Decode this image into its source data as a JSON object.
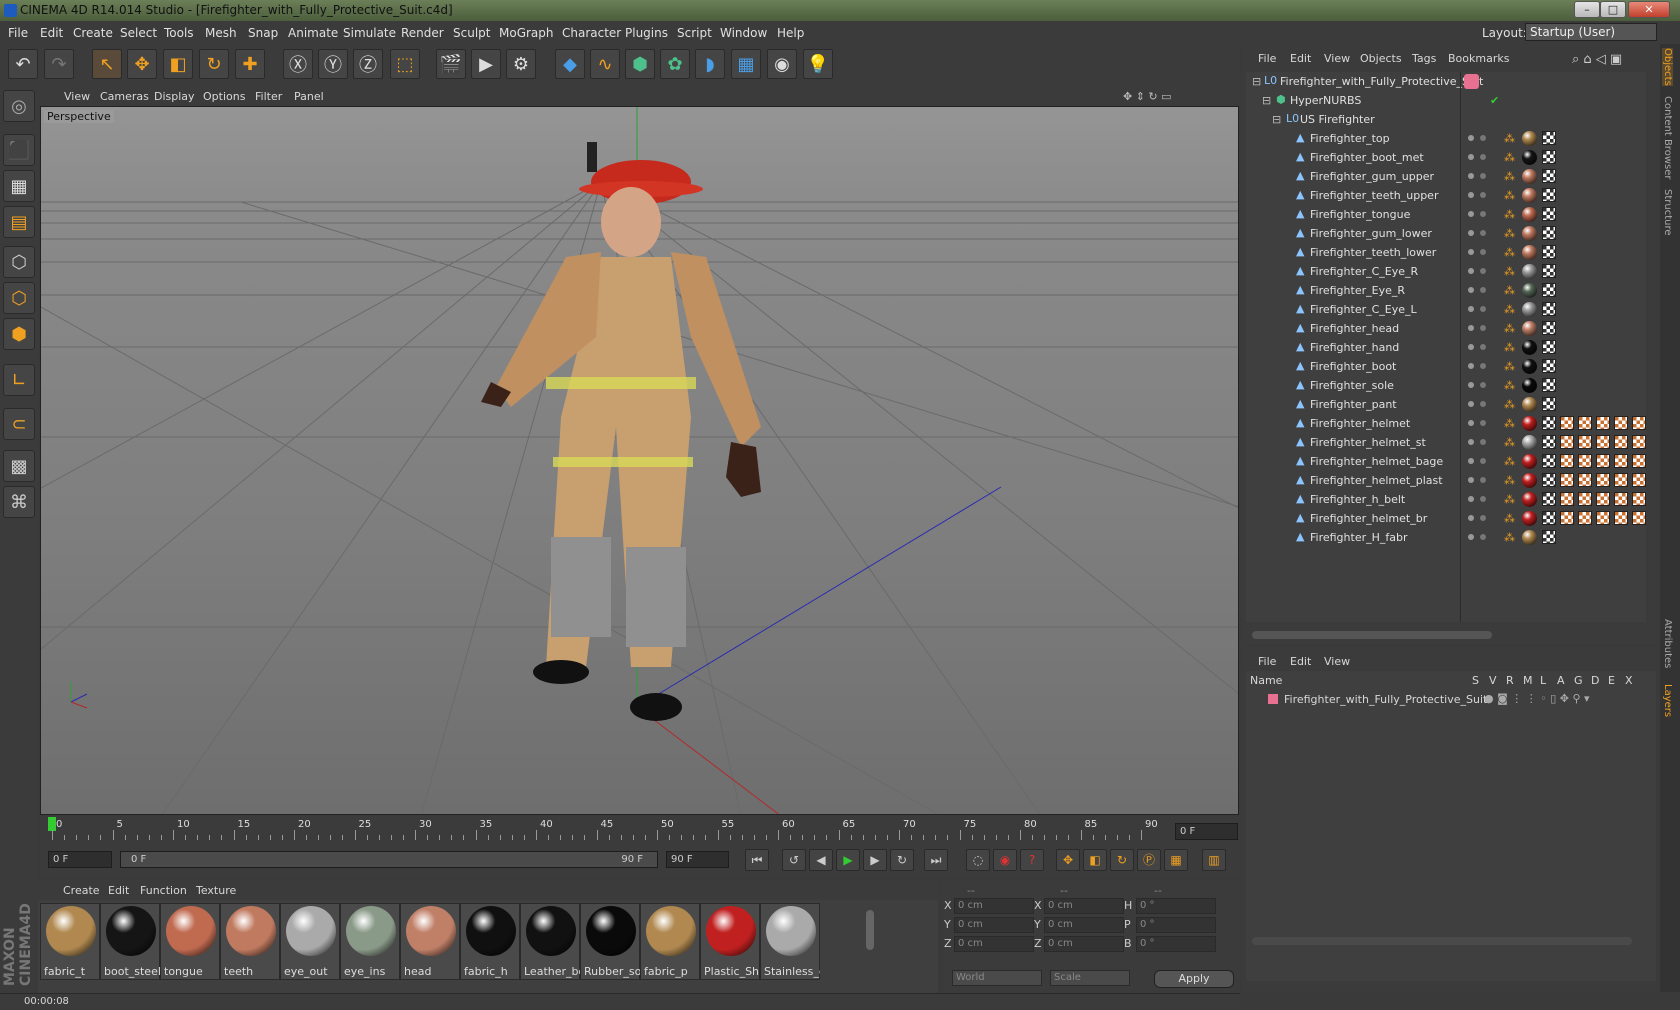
{
  "window": {
    "title": "CINEMA 4D R14.014 Studio - [Firefighter_with_Fully_Protective_Suit.c4d]",
    "buttons": [
      "–",
      "□",
      "✕"
    ]
  },
  "menubar": {
    "items": [
      "File",
      "Edit",
      "Create",
      "Select",
      "Tools",
      "Mesh",
      "Snap",
      "Animate",
      "Simulate",
      "Render",
      "Sculpt",
      "MoGraph",
      "Character",
      "Plugins",
      "Script",
      "Window",
      "Help"
    ],
    "layout_label": "Layout:",
    "layout_value": "Startup (User)"
  },
  "toolbar": {
    "icons": [
      "undo-icon",
      "redo-icon",
      "live-selection-icon",
      "move-icon",
      "scale-icon",
      "rotate-icon",
      "add-icon",
      "x-axis-icon",
      "y-axis-icon",
      "z-axis-icon",
      "coordinate-system-icon",
      "render-view-icon",
      "render-picture-viewer-icon",
      "render-settings-icon",
      "cube-icon",
      "spline-icon",
      "nurbs-icon",
      "array-icon",
      "deformer-icon",
      "floor-icon",
      "camera-icon",
      "light-icon"
    ]
  },
  "viewport": {
    "menu": [
      "View",
      "Cameras",
      "Display",
      "Options",
      "Filter",
      "Panel"
    ],
    "label": "Perspective"
  },
  "timeline": {
    "ticks": [
      "0",
      "5",
      "10",
      "15",
      "20",
      "25",
      "30",
      "35",
      "40",
      "45",
      "50",
      "55",
      "60",
      "65",
      "70",
      "75",
      "80",
      "85",
      "90"
    ],
    "current_frame": "0 F",
    "start_frame": "0 F",
    "range_start": "0 F",
    "range_end": "90 F",
    "end_frame": "90 F"
  },
  "materials": {
    "menu": [
      "Create",
      "Edit",
      "Function",
      "Texture"
    ],
    "items": [
      {
        "label": "fabric_t",
        "color": "#b08850"
      },
      {
        "label": "boot_steel",
        "color": "#151515"
      },
      {
        "label": "tongue",
        "color": "#c06a50"
      },
      {
        "label": "teeth",
        "color": "#c07a60"
      },
      {
        "label": "eye_out",
        "color": "#aaaaaa"
      },
      {
        "label": "eye_ins",
        "color": "#8a9a88"
      },
      {
        "label": "head",
        "color": "#c08068"
      },
      {
        "label": "fabric_h",
        "color": "#101010"
      },
      {
        "label": "Leather_bo",
        "color": "#111111"
      },
      {
        "label": "Rubber_so",
        "color": "#0a0a0a"
      },
      {
        "label": "fabric_p",
        "color": "#b08850"
      },
      {
        "label": "Plastic_Shir",
        "color": "#c02020"
      },
      {
        "label": "Stainless_d",
        "color": "#aaaaaa"
      }
    ]
  },
  "coords": {
    "header": [
      "--",
      "--",
      "--"
    ],
    "rows": [
      {
        "a": "X",
        "av": "0 cm",
        "b": "X",
        "bv": "0 cm",
        "c": "H",
        "cv": "0 °"
      },
      {
        "a": "Y",
        "av": "0 cm",
        "b": "Y",
        "bv": "0 cm",
        "c": "P",
        "cv": "0 °"
      },
      {
        "a": "Z",
        "av": "0 cm",
        "b": "Z",
        "bv": "0 cm",
        "c": "B",
        "cv": "0 °"
      }
    ],
    "world": "World",
    "scale": "Scale",
    "apply": "Apply"
  },
  "status": {
    "time": "00:00:08"
  },
  "objects": {
    "menu": [
      "File",
      "Edit",
      "View",
      "Objects",
      "Tags",
      "Bookmarks"
    ],
    "root": "Firefighter_with_Fully_Protective_Suit",
    "hypernurbs": "HyperNURBS",
    "group": "US Firefighter",
    "children": [
      {
        "name": "Firefighter_top",
        "mat": "#b08850",
        "extra": 0
      },
      {
        "name": "Firefighter_boot_met",
        "mat": "#151515",
        "extra": 0
      },
      {
        "name": "Firefighter_gum_upper",
        "mat": "#c07a60",
        "extra": 0
      },
      {
        "name": "Firefighter_teeth_upper",
        "mat": "#c07a60",
        "extra": 0
      },
      {
        "name": "Firefighter_tongue",
        "mat": "#c06a50",
        "extra": 0
      },
      {
        "name": "Firefighter_gum_lower",
        "mat": "#c07a60",
        "extra": 0
      },
      {
        "name": "Firefighter_teeth_lower",
        "mat": "#c07a60",
        "extra": 0
      },
      {
        "name": "Firefighter_C_Eye_R",
        "mat": "#999999",
        "extra": 0
      },
      {
        "name": "Firefighter_Eye_R",
        "mat": "#556655",
        "extra": 0
      },
      {
        "name": "Firefighter_C_Eye_L",
        "mat": "#999999",
        "extra": 0
      },
      {
        "name": "Firefighter_head",
        "mat": "#c08068",
        "extra": 0
      },
      {
        "name": "Firefighter_hand",
        "mat": "#101010",
        "extra": 0
      },
      {
        "name": "Firefighter_boot",
        "mat": "#111111",
        "extra": 0
      },
      {
        "name": "Firefighter_sole",
        "mat": "#0a0a0a",
        "extra": 0
      },
      {
        "name": "Firefighter_pant",
        "mat": "#b08850",
        "extra": 0
      },
      {
        "name": "Firefighter_helmet",
        "mat": "#c02020",
        "extra": 5
      },
      {
        "name": "Firefighter_helmet_st",
        "mat": "#aaaaaa",
        "extra": 5
      },
      {
        "name": "Firefighter_helmet_bage",
        "mat": "#c02020",
        "extra": 5
      },
      {
        "name": "Firefighter_helmet_plast",
        "mat": "#c02020",
        "extra": 5
      },
      {
        "name": "Firefighter_h_belt",
        "mat": "#c02020",
        "extra": 5
      },
      {
        "name": "Firefighter_helmet_br",
        "mat": "#c02020",
        "extra": 5
      },
      {
        "name": "Firefighter_H_fabr",
        "mat": "#b08850",
        "extra": 0
      }
    ]
  },
  "layers": {
    "menu": [
      "File",
      "Edit",
      "View"
    ],
    "header_name": "Name",
    "cols": [
      "S",
      "V",
      "R",
      "M",
      "L",
      "A",
      "G",
      "D",
      "E",
      "X"
    ],
    "row": "Firefighter_with_Fully_Protective_Suit"
  },
  "side_tabs": [
    "Objects",
    "Content Browser",
    "Structure",
    "Attributes",
    "Layers"
  ]
}
